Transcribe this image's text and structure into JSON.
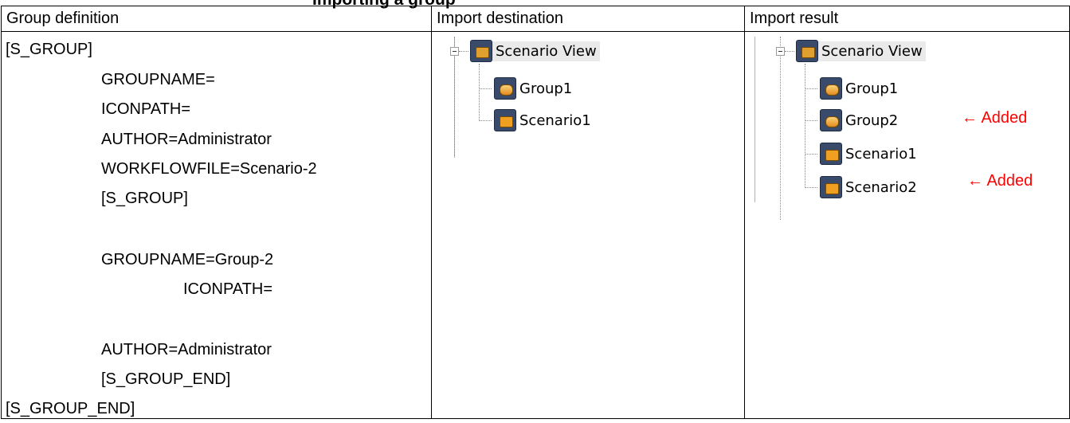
{
  "caption": "Importing a group",
  "headers": {
    "col1": "Group definition",
    "col2": "Import destination",
    "col3": "Import result"
  },
  "definition_lines": [
    "[S_GROUP]",
    "GROUPNAME=",
    "ICONPATH=",
    "AUTHOR=Administrator",
    "WORKFLOWFILE=Scenario-2",
    "[S_GROUP]",
    "GROUPNAME=Group-2",
    "ICONPATH=",
    "AUTHOR=Administrator",
    "[S_GROUP_END]",
    "[S_GROUP_END]"
  ],
  "destination_tree": {
    "root": "Scenario View",
    "children": [
      "Group1",
      "Scenario1"
    ]
  },
  "result_tree": {
    "root": "Scenario View",
    "children": [
      "Group1",
      "Group2",
      "Scenario1",
      "Scenario2"
    ]
  },
  "added_note": "← Added",
  "icons": {
    "root": "scenario-view-icon",
    "group": "group-icon",
    "scenario": "scenario-icon"
  },
  "colors": {
    "note": "#ff0000"
  }
}
